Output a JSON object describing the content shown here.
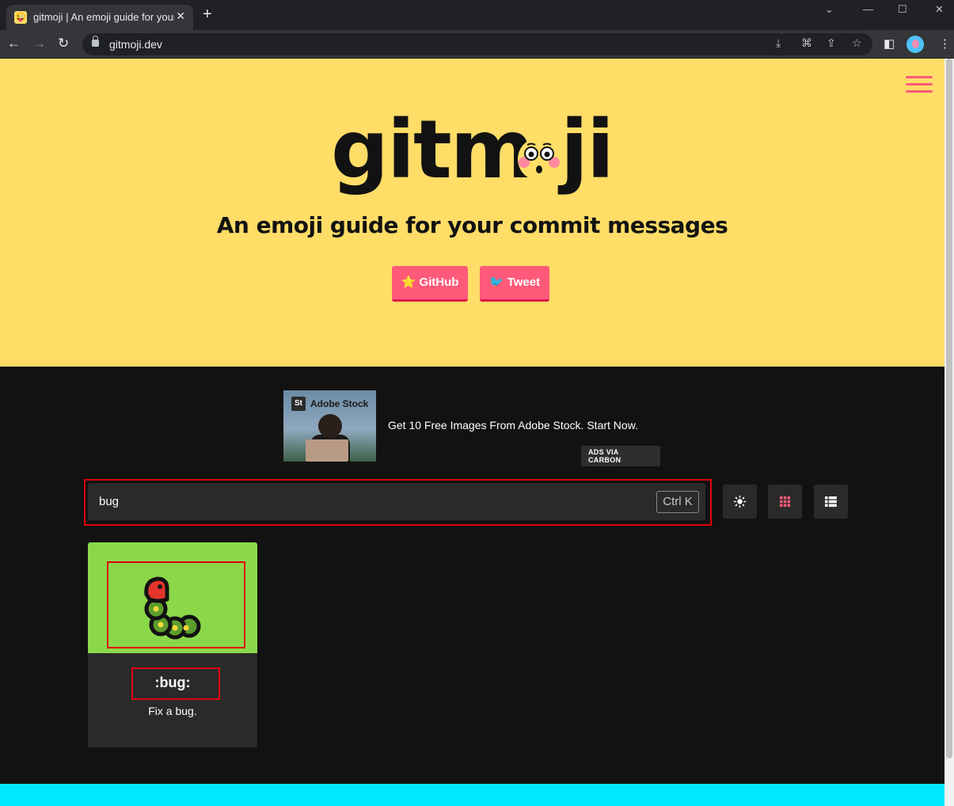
{
  "browser": {
    "tab_title": "gitmoji | An emoji guide for your commit messages",
    "url": "gitmoji.dev",
    "new_tab_symbol": "+",
    "close_symbol": "✕"
  },
  "hero": {
    "logo_left": "gitm",
    "logo_right": "ji",
    "tagline": "An emoji guide for your commit messages",
    "github_label": "⭐ GitHub",
    "tweet_label": "🐦 Tweet"
  },
  "ad": {
    "brand": "Adobe Stock",
    "brand_badge": "St",
    "text": "Get 10 Free Images From Adobe Stock. Start Now.",
    "via": "ADS VIA CARBON"
  },
  "search": {
    "value": "bug",
    "shortcut": "Ctrl K"
  },
  "results": [
    {
      "code": ":bug:",
      "description": "Fix a bug.",
      "color": "#8ad84a"
    }
  ],
  "colors": {
    "hero_bg": "#ffdd67",
    "accent": "#ff5a79",
    "footer_band": "#00e8ff"
  },
  "icons": {
    "theme_toggle": "sun-icon",
    "grid_view": "grid-icon",
    "list_view": "list-icon"
  }
}
